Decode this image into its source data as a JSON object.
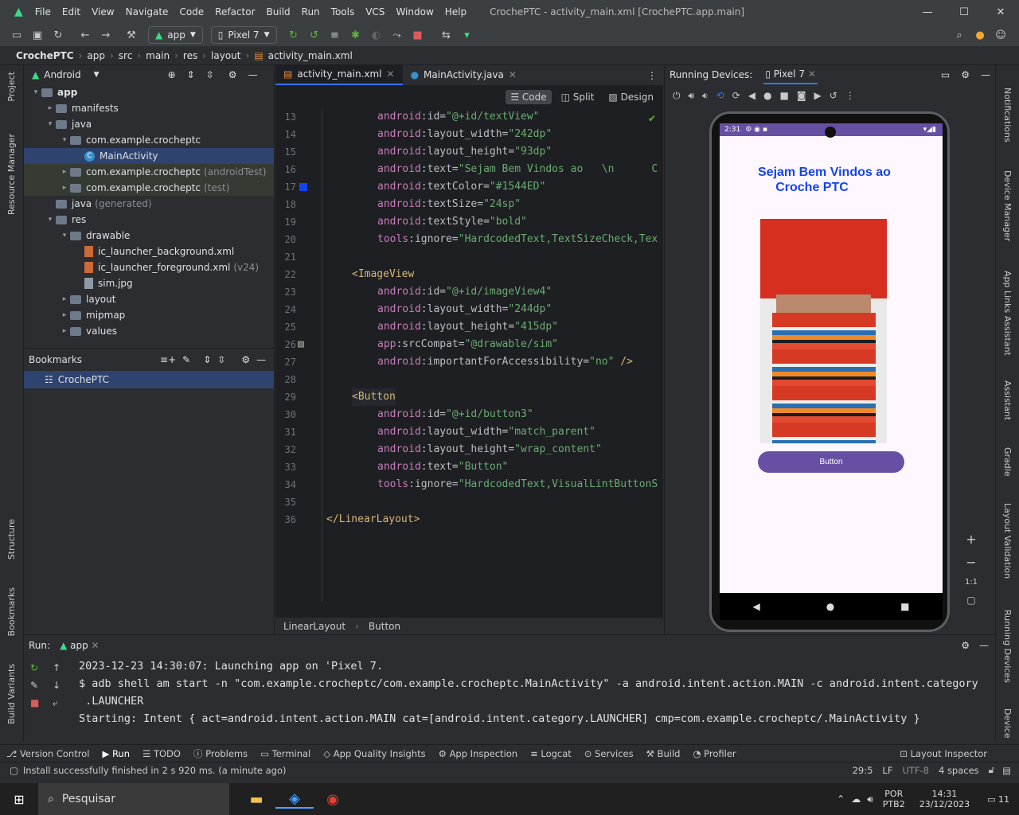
{
  "window": {
    "menus": [
      "File",
      "Edit",
      "View",
      "Navigate",
      "Code",
      "Refactor",
      "Build",
      "Run",
      "Tools",
      "VCS",
      "Window",
      "Help"
    ],
    "title": "CrochePTC - activity_main.xml [CrochePTC.app.main]"
  },
  "toolbar": {
    "run_config": "app",
    "device": "Pixel 7"
  },
  "breadcrumb": [
    "CrochePTC",
    "app",
    "src",
    "main",
    "res",
    "layout",
    "activity_main.xml"
  ],
  "project": {
    "view": "Android",
    "tree": [
      {
        "label": "app",
        "indent": 0,
        "arrow": "▾",
        "kind": "folder",
        "bold": true
      },
      {
        "label": "manifests",
        "indent": 1,
        "arrow": "▸",
        "kind": "folder"
      },
      {
        "label": "java",
        "indent": 1,
        "arrow": "▾",
        "kind": "folder"
      },
      {
        "label": "com.example.crocheptc",
        "indent": 2,
        "arrow": "▾",
        "kind": "folder"
      },
      {
        "label": "MainActivity",
        "indent": 3,
        "arrow": "",
        "kind": "class",
        "selected": true
      },
      {
        "label": "com.example.crocheptc",
        "suffix": "(androidTest)",
        "indent": 2,
        "arrow": "▸",
        "kind": "folder",
        "hl": true
      },
      {
        "label": "com.example.crocheptc",
        "suffix": "(test)",
        "indent": 2,
        "arrow": "▸",
        "kind": "folder",
        "hl": true
      },
      {
        "label": "java",
        "suffix": "(generated)",
        "indent": 1,
        "arrow": "",
        "kind": "folder"
      },
      {
        "label": "res",
        "indent": 1,
        "arrow": "▾",
        "kind": "folder"
      },
      {
        "label": "drawable",
        "indent": 2,
        "arrow": "▾",
        "kind": "folder"
      },
      {
        "label": "ic_launcher_background.xml",
        "indent": 3,
        "arrow": "",
        "kind": "file"
      },
      {
        "label": "ic_launcher_foreground.xml",
        "suffix": "(v24)",
        "indent": 3,
        "arrow": "",
        "kind": "file"
      },
      {
        "label": "sim.jpg",
        "indent": 3,
        "arrow": "",
        "kind": "img"
      },
      {
        "label": "layout",
        "indent": 2,
        "arrow": "▸",
        "kind": "folder"
      },
      {
        "label": "mipmap",
        "indent": 2,
        "arrow": "▸",
        "kind": "folder"
      },
      {
        "label": "values",
        "indent": 2,
        "arrow": "▸",
        "kind": "folder"
      }
    ]
  },
  "bookmarks": {
    "title": "Bookmarks",
    "items": [
      "CrochePTC"
    ]
  },
  "editor": {
    "tabs": [
      {
        "label": "activity_main.xml",
        "active": true
      },
      {
        "label": "MainActivity.java",
        "active": false
      }
    ],
    "modes": [
      "Code",
      "Split",
      "Design"
    ],
    "lines": [
      {
        "n": "13",
        "i": 2,
        "parts": [
          [
            "attr",
            "android"
          ],
          [
            "tool",
            ":id="
          ],
          [
            "val",
            "\"@+id/textView\""
          ]
        ]
      },
      {
        "n": "14",
        "i": 2,
        "parts": [
          [
            "attr",
            "android"
          ],
          [
            "tool",
            ":layout_width="
          ],
          [
            "val",
            "\"242dp\""
          ]
        ]
      },
      {
        "n": "15",
        "i": 2,
        "parts": [
          [
            "attr",
            "android"
          ],
          [
            "tool",
            ":layout_height="
          ],
          [
            "val",
            "\"93dp\""
          ]
        ]
      },
      {
        "n": "16",
        "i": 2,
        "parts": [
          [
            "attr",
            "android"
          ],
          [
            "tool",
            ":text="
          ],
          [
            "val",
            "\"Sejam Bem Vindos ao   \\n      C"
          ]
        ]
      },
      {
        "n": "17",
        "i": 2,
        "parts": [
          [
            "attr",
            "android"
          ],
          [
            "tool",
            ":textColor="
          ],
          [
            "val",
            "\"#1544ED\""
          ]
        ]
      },
      {
        "n": "18",
        "i": 2,
        "parts": [
          [
            "attr",
            "android"
          ],
          [
            "tool",
            ":textSize="
          ],
          [
            "val",
            "\"24sp\""
          ]
        ]
      },
      {
        "n": "19",
        "i": 2,
        "parts": [
          [
            "attr",
            "android"
          ],
          [
            "tool",
            ":textStyle="
          ],
          [
            "val",
            "\"bold\""
          ]
        ]
      },
      {
        "n": "20",
        "i": 2,
        "parts": [
          [
            "attr",
            "tools"
          ],
          [
            "tool",
            ":ignore="
          ],
          [
            "val",
            "\"HardcodedText,TextSizeCheck,Tex"
          ]
        ]
      },
      {
        "n": "21",
        "i": 0,
        "parts": []
      },
      {
        "n": "22",
        "i": 1,
        "parts": [
          [
            "tag",
            "<ImageView"
          ]
        ]
      },
      {
        "n": "23",
        "i": 2,
        "parts": [
          [
            "attr",
            "android"
          ],
          [
            "tool",
            ":id="
          ],
          [
            "val",
            "\"@+id/imageView4\""
          ]
        ]
      },
      {
        "n": "24",
        "i": 2,
        "parts": [
          [
            "attr",
            "android"
          ],
          [
            "tool",
            ":layout_width="
          ],
          [
            "val",
            "\"244dp\""
          ]
        ]
      },
      {
        "n": "25",
        "i": 2,
        "parts": [
          [
            "attr",
            "android"
          ],
          [
            "tool",
            ":layout_height="
          ],
          [
            "val",
            "\"415dp\""
          ]
        ]
      },
      {
        "n": "26",
        "i": 2,
        "parts": [
          [
            "attr",
            "app"
          ],
          [
            "tool",
            ":srcCompat="
          ],
          [
            "val",
            "\"@drawable/sim\""
          ]
        ]
      },
      {
        "n": "27",
        "i": 2,
        "parts": [
          [
            "attr",
            "android"
          ],
          [
            "tool",
            ":importantForAccessibility="
          ],
          [
            "val",
            "\"no\""
          ],
          [
            "tag",
            " />"
          ]
        ]
      },
      {
        "n": "28",
        "i": 0,
        "parts": []
      },
      {
        "n": "29",
        "i": 1,
        "parts": [
          [
            "tag",
            "<Button"
          ]
        ]
      },
      {
        "n": "30",
        "i": 2,
        "parts": [
          [
            "attr",
            "android"
          ],
          [
            "tool",
            ":id="
          ],
          [
            "val",
            "\"@+id/button3\""
          ]
        ]
      },
      {
        "n": "31",
        "i": 2,
        "parts": [
          [
            "attr",
            "android"
          ],
          [
            "tool",
            ":layout_width="
          ],
          [
            "val",
            "\"match_parent\""
          ]
        ]
      },
      {
        "n": "32",
        "i": 2,
        "parts": [
          [
            "attr",
            "android"
          ],
          [
            "tool",
            ":layout_height="
          ],
          [
            "val",
            "\"wrap_content\""
          ]
        ]
      },
      {
        "n": "33",
        "i": 2,
        "parts": [
          [
            "attr",
            "android"
          ],
          [
            "tool",
            ":text="
          ],
          [
            "val",
            "\"Button\""
          ]
        ]
      },
      {
        "n": "34",
        "i": 2,
        "parts": [
          [
            "attr",
            "tools"
          ],
          [
            "tool",
            ":ignore="
          ],
          [
            "val",
            "\"HardcodedText,VisualLintButtonS"
          ]
        ]
      },
      {
        "n": "35",
        "i": 0,
        "parts": []
      },
      {
        "n": "36",
        "i": 0,
        "parts": [
          [
            "tag",
            "</LinearLayout>"
          ]
        ]
      }
    ],
    "footer": [
      "LinearLayout",
      "Button"
    ]
  },
  "devices": {
    "label": "Running Devices:",
    "tab": "Pixel 7",
    "phone_time": "2:31",
    "app_title": "Sejam Bem Vindos ao\n     Croche PTC",
    "app_title_color": "#1544ED",
    "button": "Button",
    "button_color": "#6750a4",
    "zoom": "1:1"
  },
  "run": {
    "label": "Run:",
    "tab": "app",
    "console": [
      "2023-12-23 14:30:07: Launching app on 'Pixel 7.",
      "$ adb shell am start -n \"com.example.crocheptc/com.example.crocheptc.MainActivity\" -a android.intent.action.MAIN -c android.intent.category",
      " .LAUNCHER",
      "",
      "Starting: Intent { act=android.intent.action.MAIN cat=[android.intent.category.LAUNCHER] cmp=com.example.crocheptc/.MainActivity }"
    ]
  },
  "bottom_tools": [
    "Version Control",
    "Run",
    "TODO",
    "Problems",
    "Terminal",
    "App Quality Insights",
    "App Inspection",
    "Logcat",
    "Services",
    "Build",
    "Profiler"
  ],
  "layout_inspector": "Layout Inspector",
  "status": {
    "message": "Install successfully finished in 2 s 920 ms. (a minute ago)",
    "position": "29:5",
    "line_sep": "LF",
    "encoding": "UTF-8",
    "indent": "4 spaces"
  },
  "taskbar": {
    "search": "Pesquisar",
    "lang1": "POR",
    "lang2": "PTB2",
    "time": "14:31",
    "date": "23/12/2023",
    "notif": "11"
  },
  "side_left": [
    "Project",
    "Resource Manager",
    "Structure",
    "Bookmarks",
    "Build Variants"
  ],
  "side_right": [
    "Notifications",
    "Device Manager",
    "App Links Assistant",
    "Assistant",
    "Gradle",
    "Layout Validation",
    "Running Devices",
    "Device"
  ]
}
